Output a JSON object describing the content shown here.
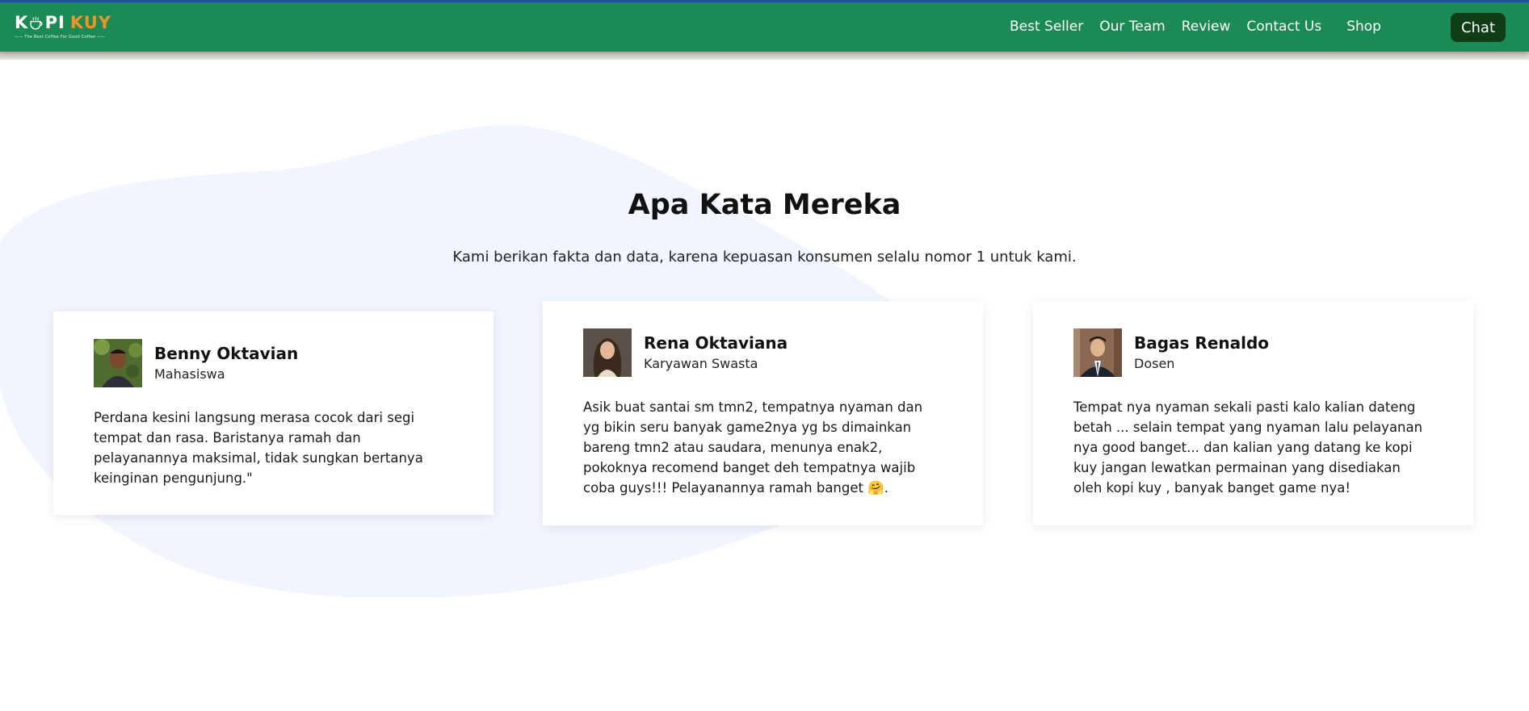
{
  "brand": {
    "name_part1": "K",
    "name_part2": "PI",
    "name_part3": "KUY",
    "tagline": "—— The Best Coffee For Good Coffee ——",
    "accent_color": "#f0932b",
    "nav_color": "#1b8a55"
  },
  "nav": {
    "links": [
      {
        "label": "Best Seller"
      },
      {
        "label": "Our Team"
      },
      {
        "label": "Review"
      },
      {
        "label": "Contact Us"
      },
      {
        "label": "Shop"
      }
    ],
    "chat_label": "Chat"
  },
  "testimonials": {
    "title": "Apa Kata Mereka",
    "subtitle": "Kami berikan fakta dan data, karena kepuasan konsumen selalu nomor 1 untuk kami.",
    "cards": [
      {
        "name": "Benny Oktavian",
        "role": "Mahasiswa",
        "avatar_icon": "man-portrait-avatar",
        "quote": "Perdana kesini langsung merasa cocok dari segi tempat dan rasa. Baristanya ramah dan pelayanannya maksimal, tidak sungkan bertanya keinginan pengunjung.\""
      },
      {
        "name": "Rena Oktaviana",
        "role": "Karyawan Swasta",
        "avatar_icon": "woman-portrait-avatar",
        "quote": "Asik buat santai sm tmn2, tempatnya nyaman dan yg bikin seru banyak game2nya yg bs dimainkan bareng tmn2 atau saudara, menunya enak2, pokoknya recomend banget deh tempatnya wajib coba guys!!! Pelayanannya ramah banget 🤗."
      },
      {
        "name": "Bagas Renaldo",
        "role": "Dosen",
        "avatar_icon": "man-suit-portrait-avatar",
        "quote": "Tempat nya nyaman sekali pasti kalo kalian dateng betah ... selain tempat yang nyaman lalu pelayanan nya good banget... dan kalian yang datang ke kopi kuy jangan lewatkan permainan yang disediakan oleh kopi kuy , banyak banget game nya!"
      }
    ]
  }
}
